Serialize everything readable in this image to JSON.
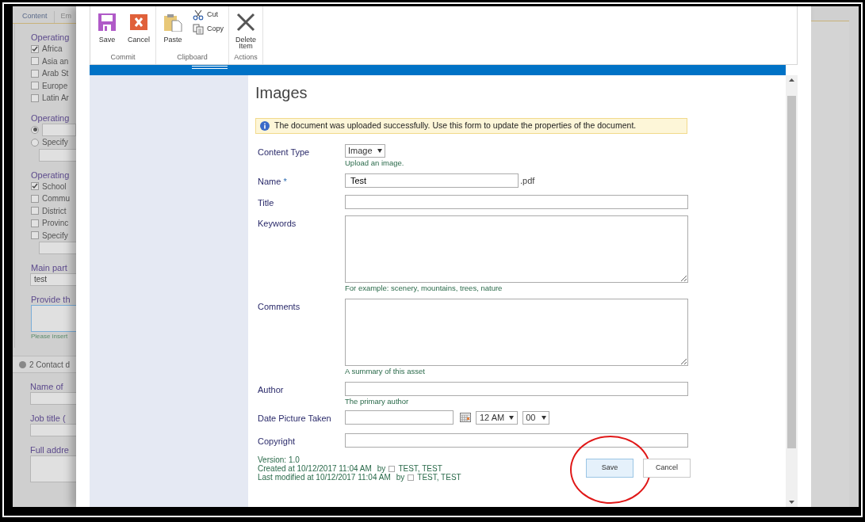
{
  "background_form": {
    "tabs": [
      {
        "label": "Content",
        "selected": true
      },
      {
        "label": "Em",
        "selected": false
      }
    ],
    "groups": [
      {
        "label": "Operating",
        "kind": "checkboxes",
        "options": [
          {
            "label": "Africa",
            "checked": true,
            "kind": "plain"
          },
          {
            "label": "Asia an",
            "checked": false,
            "kind": "plain"
          },
          {
            "label": "Arab St",
            "checked": false,
            "kind": "plain"
          },
          {
            "label": "Europe",
            "checked": false,
            "kind": "plain"
          },
          {
            "label": "Latin Ar",
            "checked": false,
            "kind": "plain"
          }
        ]
      },
      {
        "label": "Operating",
        "kind": "radios",
        "options": [
          {
            "selected": true,
            "kind": "field"
          },
          {
            "label": "Specify",
            "selected": false,
            "kind": "specify"
          }
        ]
      },
      {
        "label": "Operating",
        "kind": "checkboxes",
        "options": [
          {
            "label": "School",
            "checked": true,
            "kind": "plain"
          },
          {
            "label": "Commu",
            "checked": false,
            "kind": "plain"
          },
          {
            "label": "District",
            "checked": false,
            "kind": "plain"
          },
          {
            "label": "Provinc",
            "checked": false,
            "kind": "plain"
          },
          {
            "label": "Specify",
            "checked": false,
            "kind": "specify"
          }
        ]
      },
      {
        "label": "Main part",
        "kind": "text",
        "value": "test"
      },
      {
        "label": "Provide th",
        "kind": "textarea",
        "hint": "Please insert"
      }
    ],
    "section": {
      "title": "2 Contact d"
    },
    "section_fields": [
      {
        "label": "Name of",
        "kind": "text"
      },
      {
        "label": "Job title (",
        "kind": "text"
      },
      {
        "label": "Full addre",
        "kind": "textarea"
      }
    ]
  },
  "ribbon": {
    "groups": [
      {
        "label": "Commit",
        "buttons": [
          {
            "label": "Save",
            "kind": "large"
          },
          {
            "label": "Cancel",
            "kind": "large"
          }
        ]
      },
      {
        "label": "Clipboard",
        "buttons": [
          {
            "label": "Paste",
            "kind": "large"
          },
          {
            "label": "Cut",
            "kind": "small"
          },
          {
            "label": "Copy",
            "kind": "small"
          }
        ]
      },
      {
        "label": "Actions",
        "buttons": [
          {
            "label": "Delete Item",
            "kind": "large"
          }
        ]
      }
    ]
  },
  "dialog": {
    "title": "Images",
    "notice": "The document was uploaded successfully. Use this form to update the properties of the document.",
    "fields": [
      {
        "label": "Content Type",
        "kind": "select",
        "value": "Image",
        "hint": "Upload an image."
      },
      {
        "label": "Name",
        "required_mark": "*",
        "kind": "text",
        "value": "Test",
        "suffix": ".pdf"
      },
      {
        "label": "Title",
        "kind": "text"
      },
      {
        "label": "Keywords",
        "kind": "textarea",
        "hint": "For example: scenery, mountains, trees, nature"
      },
      {
        "label": "Comments",
        "kind": "textarea",
        "hint": "A summary of this asset"
      },
      {
        "label": "Author",
        "kind": "text",
        "hint": "The primary author"
      },
      {
        "label": "Date Picture Taken",
        "kind": "datetime",
        "hour": "12 AM",
        "minute": "00"
      },
      {
        "label": "Copyright",
        "kind": "text"
      }
    ],
    "version": "Version: 1.0",
    "history": [
      {
        "text": "Created at 10/12/2017 11:04 AM",
        "by": "by",
        "user": "TEST, TEST"
      },
      {
        "text": "Last modified at 10/12/2017 11:04 AM",
        "by": "by",
        "user": "TEST, TEST"
      }
    ],
    "buttons": [
      {
        "label": "Save",
        "primary": true,
        "highlighted": true
      },
      {
        "label": "Cancel",
        "primary": false,
        "highlighted": false
      }
    ]
  }
}
